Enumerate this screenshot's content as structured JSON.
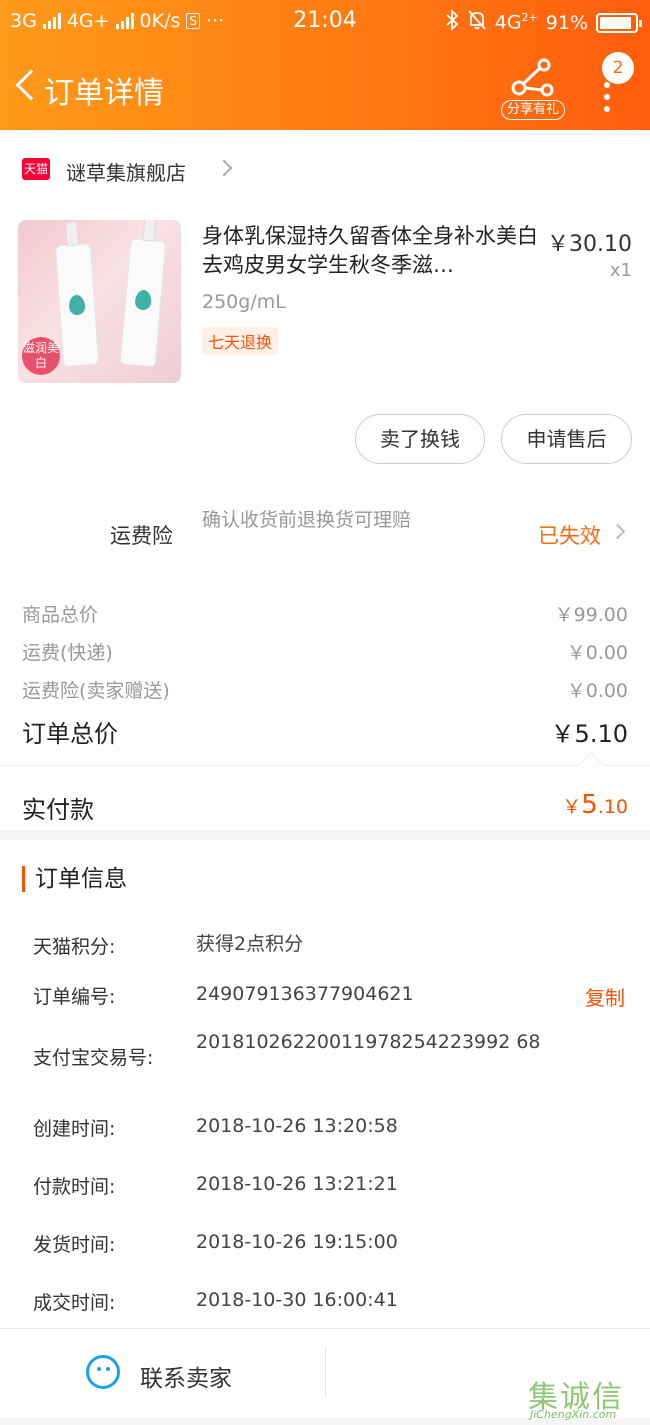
{
  "status_bar": {
    "network_1": "3G",
    "network_2": "4G+",
    "speed": "0K/s",
    "s_icon_label": "S",
    "more": "···",
    "time": "21:04",
    "network_3": "4G",
    "network_3_sub": "2+",
    "battery_percent": "91%"
  },
  "nav": {
    "title": "订单详情",
    "share_label": "分享有礼",
    "more_badge": "2"
  },
  "store": {
    "badge": "天猫",
    "name": "谜草集旗舰店"
  },
  "product": {
    "title": "身体乳保湿持久留香体全身补水美白去鸡皮男女学生秋冬季滋…",
    "spec": "250g/mL",
    "tag": "七天退换",
    "price": "￥30.10",
    "qty": "x1",
    "image_badge": "滋润美白"
  },
  "actions": {
    "sell_label": "卖了换钱",
    "after_sale_label": "申请售后"
  },
  "insurance": {
    "label": "运费险",
    "desc": "确认收货前退换货可理赔",
    "status": "已失效"
  },
  "price_summary": {
    "rows": [
      {
        "label": "商品总价",
        "value": "￥99.00"
      },
      {
        "label": "运费(快递)",
        "value": "￥0.00"
      },
      {
        "label": "运费险(卖家赠送)",
        "value": "￥0.00"
      }
    ],
    "total_label": "订单总价",
    "total_value": "￥5.10",
    "paid_label": "实付款",
    "paid_currency": "￥",
    "paid_int": "5",
    "paid_dec": ".10"
  },
  "order_info": {
    "title": "订单信息",
    "copy_label": "复制",
    "rows": [
      {
        "key": "天猫积分:",
        "value": "获得2点积分"
      },
      {
        "key": "订单编号:",
        "value": "249079136377904621"
      },
      {
        "key": "支付宝交易号:",
        "value": "20181026220011978254223992 68"
      },
      {
        "key": "创建时间:",
        "value": "2018-10-26 13:20:58"
      },
      {
        "key": "付款时间:",
        "value": "2018-10-26 13:21:21"
      },
      {
        "key": "发货时间:",
        "value": "2018-10-26 19:15:00"
      },
      {
        "key": "成交时间:",
        "value": "2018-10-30 16:00:41"
      }
    ]
  },
  "bottom": {
    "contact_label": "联系卖家"
  },
  "watermark": {
    "glyphs": "集诚信",
    "url": "JiChengXin.com"
  },
  "colors": {
    "header_start": "#ff9a1a",
    "header_end": "#ff5d0d",
    "accent": "#ff5000",
    "link_blue": "#1aa3e8"
  }
}
